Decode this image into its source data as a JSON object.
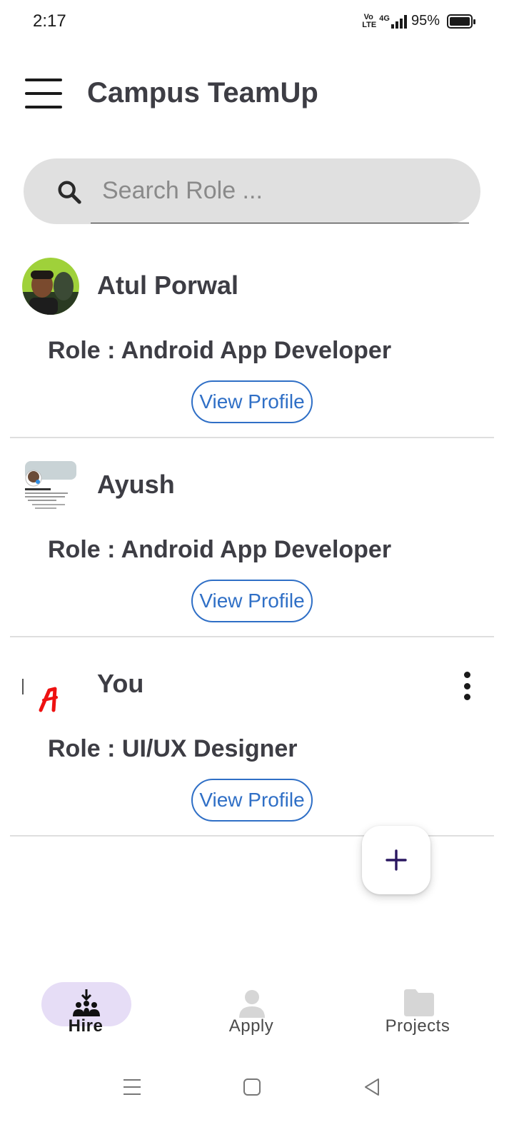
{
  "status_bar": {
    "time": "2:17",
    "volte": "Vo LTE",
    "network": "4G",
    "battery": "95%"
  },
  "app_bar": {
    "title": "Campus TeamUp",
    "menu_icon": "hamburger-menu-icon"
  },
  "search": {
    "placeholder": "Search Role ...",
    "value": "",
    "icon": "search-icon"
  },
  "cards": [
    {
      "name": "Atul Porwal",
      "role": "Role : Android App Developer",
      "button": "View Profile",
      "has_more_menu": false
    },
    {
      "name": "Ayush",
      "role": "Role : Android App Developer",
      "button": "View Profile",
      "has_more_menu": false
    },
    {
      "name": "You",
      "role": "Role : UI/UX Designer",
      "button": "View Profile",
      "has_more_menu": true
    }
  ],
  "fab": {
    "icon": "plus-icon"
  },
  "bottom_nav": {
    "items": [
      {
        "label": "Hire",
        "icon": "hire-people-icon",
        "active": true
      },
      {
        "label": "Apply",
        "icon": "person-icon",
        "active": false
      },
      {
        "label": "Projects",
        "icon": "folder-icon",
        "active": false
      }
    ]
  },
  "colors": {
    "accent": "#2f6fc6",
    "nav_active_pill": "#e6ddf6",
    "search_bg": "#e0e0e0",
    "fab_plus": "#2a1760"
  }
}
